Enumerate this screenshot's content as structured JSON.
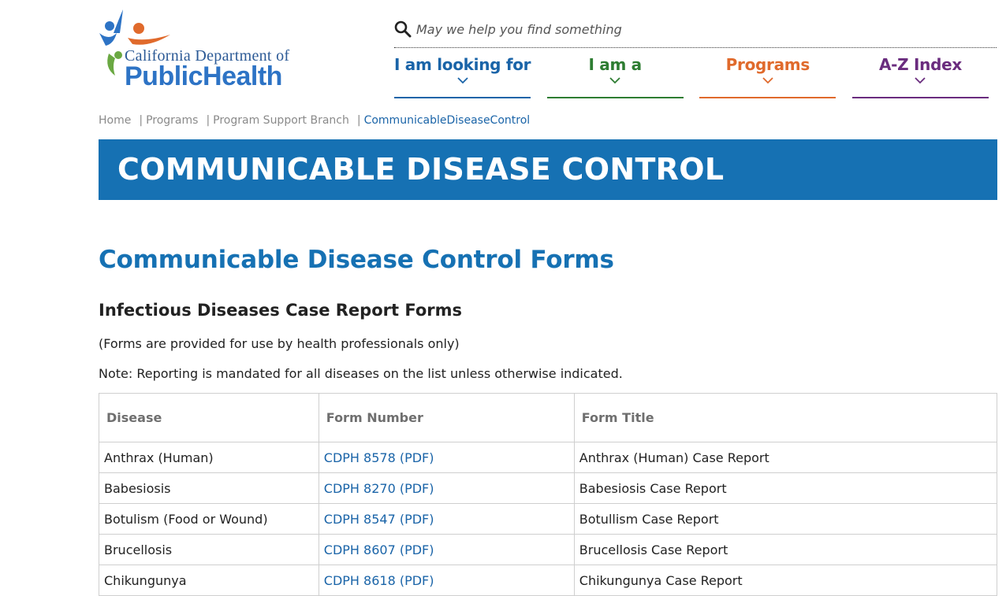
{
  "logo": {
    "line1": "California Department of",
    "line2": "PublicHealth"
  },
  "search": {
    "placeholder": "May we help you find something"
  },
  "nav": {
    "items": [
      {
        "label": "I am looking for",
        "color": "#1a64a8"
      },
      {
        "label": "I am a",
        "color": "#2e7d32"
      },
      {
        "label": "Programs",
        "color": "#e06a2c"
      },
      {
        "label": "A-Z Index",
        "color": "#6a2c7e"
      }
    ]
  },
  "breadcrumb": {
    "items": [
      "Home",
      "Programs",
      "Program Support Branch"
    ],
    "current": "CommunicableDiseaseControl"
  },
  "banner": {
    "title": "COMMUNICABLE DISEASE CONTROL"
  },
  "main": {
    "heading": "Communicable Disease Control Forms",
    "section_heading": "Infectious Diseases Case Report Forms",
    "note1": "(Forms are provided for use by health professionals only)",
    "note2": "Note: Reporting is mandated for all diseases on the list unless otherwise indicated."
  },
  "table": {
    "headers": [
      "Disease",
      "Form Number",
      "Form Title"
    ],
    "rows": [
      {
        "disease": "Anthrax (Human)",
        "form_number": "CDPH 8578 (PDF)",
        "form_title": "Anthrax (Human) Case Report"
      },
      {
        "disease": "Babesiosis",
        "form_number": "CDPH 8270 (PDF)",
        "form_title": "Babesiosis Case Report"
      },
      {
        "disease": "Botulism (Food or Wound)",
        "form_number": "CDPH 8547 (PDF)",
        "form_title": "Botullism Case Report"
      },
      {
        "disease": "Brucellosis",
        "form_number": "CDPH 8607 (PDF)",
        "form_title": "Brucellosis Case Report"
      },
      {
        "disease": "Chikungunya",
        "form_number": "CDPH 8618 (PDF)",
        "form_title": "Chikungunya Case Report"
      }
    ]
  },
  "colors": {
    "brand_blue": "#1671b3",
    "link_blue": "#1a64a8"
  }
}
